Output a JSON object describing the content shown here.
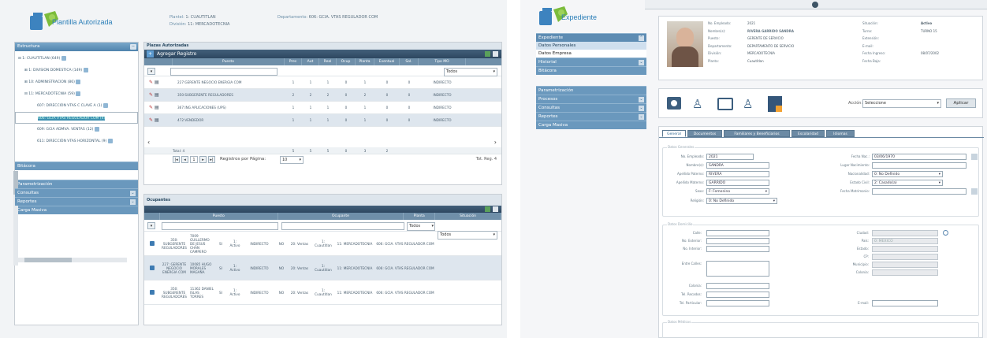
{
  "w1": {
    "app_title": "Plantilla Autorizada",
    "hdr": {
      "plantel_label": "Plantel:",
      "plantel": "1: CUAUTITLAN",
      "division_label": "División:",
      "division": "11: MERCADOTECNIA",
      "depto_label": "Departamento:",
      "depto": "606: GCIA. VTAS REGULADOR COM"
    },
    "sidebar": {
      "estructura": "Estructura",
      "tree": [
        "1: CUAUTITLAN (649)",
        "1: DIVISION DOMESTICA (149)",
        "10: ADMINISTRACION (86)",
        "11: MERCADOTECNIA (59)",
        "607: DIRECCIÓN VTAS C CLAVE A (1)",
        "606: GCIA VTAS REGULADOR COM (4)",
        "609: GCIA ADMVA. VENTAS (12)",
        "611: DIRECCIÓN VTAS HORIZONTAL (9)"
      ],
      "bitacora": "Bitácora",
      "parametrizacion": "Parametrización",
      "consultas": "Consultas",
      "reportes": "Reportes",
      "carga_masiva": "Carga Masiva"
    },
    "plazas": {
      "title": "Plazas Autorizadas",
      "add": "Agregar Registro",
      "cols": [
        "Puesto",
        "Pres",
        "Aut",
        "Real",
        "Ocup",
        "Planta",
        "Eventual",
        "Sol.",
        "Tipo MO"
      ],
      "filter_select": "Todos",
      "rows": [
        [
          "227:GERENTE NEGOCIO ENERGIA COM",
          "1",
          "1",
          "1",
          "0",
          "1",
          "0",
          "0",
          "INDIRECTO"
        ],
        [
          "350:SUBGERENTE REGULADORES",
          "2",
          "2",
          "2",
          "0",
          "2",
          "0",
          "0",
          "INDIRECTO"
        ],
        [
          "367:ING APLICACIONES (UPS)",
          "1",
          "1",
          "1",
          "0",
          "1",
          "0",
          "0",
          "INDIRECTO"
        ],
        [
          "472:VENDEDOR",
          "1",
          "1",
          "1",
          "0",
          "1",
          "0",
          "0",
          "INDIRECTO"
        ]
      ],
      "total": [
        "Total: 4",
        "5",
        "5",
        "5",
        "0",
        "3",
        "2",
        ""
      ],
      "pager": {
        "page": "1",
        "per_page_label": "Registros por Página:",
        "per_page": "10",
        "total": "Tot. Reg. 4"
      }
    },
    "ocupantes": {
      "title": "Ocupantes",
      "cols": [
        "Puesto",
        "Ocupante",
        "Planta",
        "Situación"
      ],
      "filters": [
        "Todos",
        "Todos"
      ],
      "rows": [
        [
          "350: SUBGERENTE REGULADORES",
          "7009 GUILLERMO DE JESUS CHAN CAMPERO",
          "SI",
          "1: Activo",
          "INDIRECTO",
          "NO",
          "20: Ventas",
          "1: Cuautitlan",
          "11: MERCADOTECNIA",
          "606: GCIA. VTAS REGULADOR COM"
        ],
        [
          "227: GERENTE NEGOCIO ENERGIA COM",
          "10085 HUGO MORALES MAGAÑA",
          "SI",
          "1: Activo",
          "INDIRECTO",
          "NO",
          "20: Ventas",
          "1: Cuautitlan",
          "11: MERCADOTECNIA",
          "606: GCIA. VTAS REGULADOR COM"
        ],
        [
          "350: SUBGERENTE REGULADORES",
          "11362 DANIEL ISLAS TORRES",
          "SI",
          "1: Activo",
          "INDIRECTO",
          "NO",
          "20: Ventas",
          "1: Cuautitlan",
          "11: MERCADOTECNIA",
          "606: GCIA. VTAS REGULADOR COM"
        ]
      ]
    }
  },
  "w2": {
    "app_title": "Expediente",
    "sidebar": {
      "expediente": "Expediente",
      "items": [
        "Datos Personales",
        "Datos Empresa"
      ],
      "historial": "Historial",
      "bitacora": "Bitácora",
      "parametrizacion": "Parametrización",
      "procesos": "Procesos",
      "consultas": "Consultas",
      "reportes": "Reportes",
      "carga_masiva": "Carga Masiva"
    },
    "emp": {
      "l1": [
        "No. Empleado:",
        "Nombre(s):",
        "Puesto:",
        "Departamento:",
        "División:",
        "Planta:"
      ],
      "v1": [
        "2021",
        "RIVERA GARRIDO SANDRA",
        "GERENTE DE SERVICIO",
        "DEPARTAMENTO DE SERVICIO",
        "MERCADOTECNIA",
        "Cuautitlan"
      ],
      "l2": [
        "Situación:",
        "Turno:",
        "Extensión:",
        "E-mail:",
        "Fecha Ingreso:",
        "Fecha Baja:"
      ],
      "v2": [
        "Activo",
        "TURNO 15",
        "",
        "",
        "08/07/2002",
        ""
      ]
    },
    "accion_label": "Acción:",
    "accion": "Seleccione",
    "aplicar": "Aplicar",
    "tabs": [
      "General",
      "Documentos",
      "Familiares y Beneficiarios",
      "Escolaridad",
      "Idiomas"
    ],
    "fs1": "Datos Generales",
    "f": {
      "emp_l": "No. Empleado:",
      "emp": "2021",
      "nom_l": "Nombre(s):",
      "nom": "SANDRA",
      "ap_l": "Apellido Paterno:",
      "ap": "RIVERA",
      "am_l": "Apellido Materno:",
      "am": "GARRIDO",
      "sexo_l": "Sexo:",
      "sexo": "F: Femenino",
      "rel_l": "Religión:",
      "rel": "0: No Definido",
      "fn_l": "Fecha Nac.:",
      "fn": "03/06/1970",
      "ln_l": "Lugar Nacimiento:",
      "nac_l": "Nacionalidad:",
      "nac": "0: No Definido",
      "ec_l": "Estado Civil:",
      "ec": "2: Casado(a)",
      "fm_l": "Fecha Matrimonio:"
    },
    "fs2": "Datos Domicilio",
    "d": {
      "l": [
        "Calle:",
        "No. Exterior:",
        "No. Interior:",
        "Entre Calles:",
        "Colonia:",
        "Tel. Recados:",
        "Tel. Particular:"
      ],
      "r": [
        "Ciudad:",
        "País:",
        "Estado:",
        "CP:",
        "Municipio:",
        "Colonia:",
        "E-mail:"
      ],
      "pais": "0: MEXICO"
    },
    "fs3": "Datos Médicos"
  }
}
